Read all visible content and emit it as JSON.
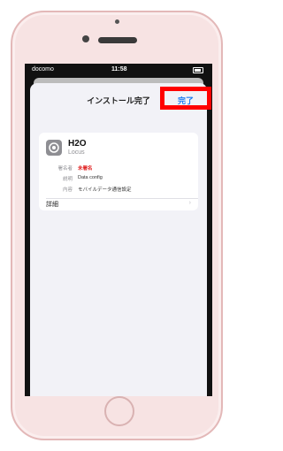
{
  "status_bar": {
    "carrier": "docomo",
    "time": "11:58"
  },
  "sheet": {
    "title": "インストール完了",
    "done_label": "完了"
  },
  "profile": {
    "name": "H2O",
    "subtitle": "Locus",
    "rows": [
      {
        "key": "署名者",
        "value": "未署名"
      },
      {
        "key": "説明",
        "value": "Data config"
      },
      {
        "key": "内容",
        "value": "モバイルデータ通信設定"
      }
    ],
    "detail_label": "詳細",
    "detail_chevron": "›"
  },
  "colors": {
    "highlight_border": "#ff0000",
    "link_blue": "#1e7cf2",
    "unsigned_red": "#e02020"
  }
}
